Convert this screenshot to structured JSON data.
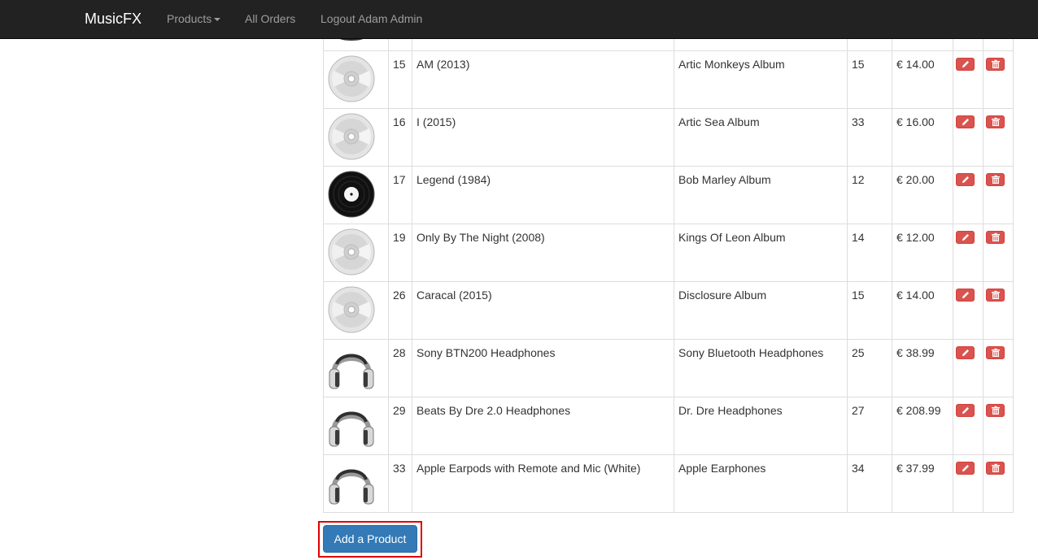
{
  "navbar": {
    "brand": "MusicFX",
    "products": "Products",
    "all_orders": "All Orders",
    "logout": "Logout Adam Admin"
  },
  "products": [
    {
      "id": "15",
      "name": "AM (2013)",
      "description": "Artic Monkeys Album",
      "quantity": "15",
      "price": "€ 14.00",
      "image": "cd-icon"
    },
    {
      "id": "16",
      "name": "I (2015)",
      "description": "Artic Sea Album",
      "quantity": "33",
      "price": "€ 16.00",
      "image": "cd-icon"
    },
    {
      "id": "17",
      "name": "Legend (1984)",
      "description": "Bob Marley Album",
      "quantity": "12",
      "price": "€ 20.00",
      "image": "vinyl-icon"
    },
    {
      "id": "19",
      "name": "Only By The Night (2008)",
      "description": "Kings Of Leon Album",
      "quantity": "14",
      "price": "€ 12.00",
      "image": "cd-icon"
    },
    {
      "id": "26",
      "name": "Caracal (2015)",
      "description": "Disclosure Album",
      "quantity": "15",
      "price": "€ 14.00",
      "image": "cd-icon"
    },
    {
      "id": "28",
      "name": "Sony BTN200 Headphones",
      "description": "Sony Bluetooth Headphones",
      "quantity": "25",
      "price": "€ 38.99",
      "image": "headphones-icon"
    },
    {
      "id": "29",
      "name": "Beats By Dre 2.0 Headphones",
      "description": "Dr. Dre Headphones",
      "quantity": "27",
      "price": "€ 208.99",
      "image": "headphones-icon"
    },
    {
      "id": "33",
      "name": "Apple Earpods with Remote and Mic (White)",
      "description": "Apple Earphones",
      "quantity": "34",
      "price": "€ 37.99",
      "image": "headphones-icon"
    }
  ],
  "actions": {
    "edit_icon": "pencil-icon",
    "delete_icon": "trash-icon",
    "add_product": "Add a Product"
  },
  "colors": {
    "navbar_bg": "#222222",
    "danger": "#d9534f",
    "primary": "#337ab7",
    "highlight_outline": "#e00000"
  }
}
